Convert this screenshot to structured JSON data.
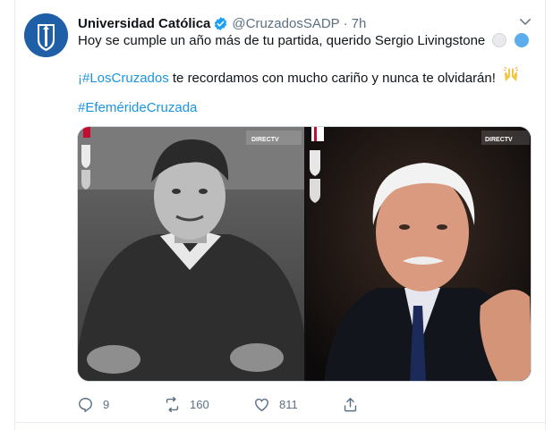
{
  "tweet": {
    "author_name": "Universidad Católica",
    "handle": "@CruzadosSADP",
    "separator": "·",
    "time": "7h",
    "line1": "Hoy se cumple un año más de tu partida, querido Sergio Livingstone",
    "line2_hashtag": "¡#LosCruzados",
    "line2_text": " te recordamos con mucho cariño y nunca te olvidarán!",
    "line2_emoji": "🙌",
    "line3_hashtag": "#Efeméride​Cruzada",
    "photo_badge": "DIRECTV"
  },
  "actions": {
    "replies": "9",
    "retweets": "160",
    "likes": "811"
  },
  "colors": {
    "accent": "#1b95e0",
    "muted": "#5b7083",
    "text": "#0f1419",
    "verified": "#1da1f2"
  },
  "icons": [
    "verified-badge-icon",
    "chevron-down-icon",
    "reply-icon",
    "retweet-icon",
    "like-icon",
    "share-icon"
  ]
}
